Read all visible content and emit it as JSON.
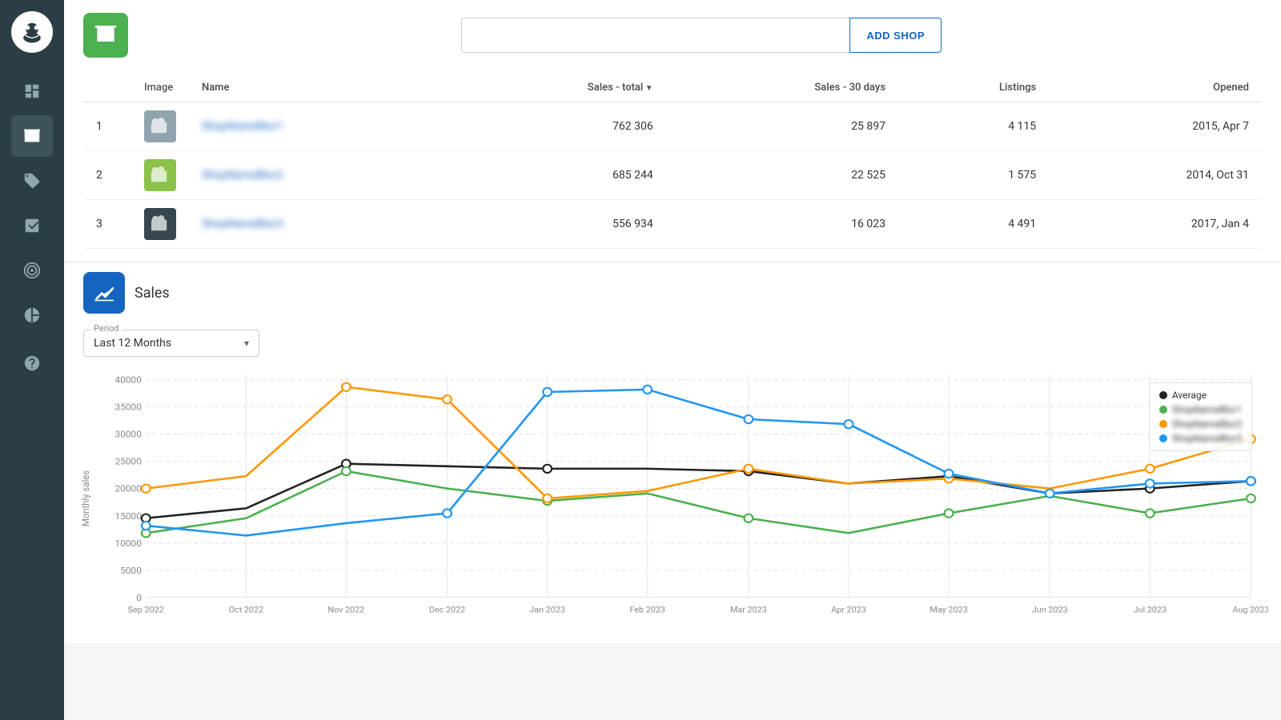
{
  "sidebar": {
    "items": [
      {
        "id": "dashboard",
        "icon": "📊",
        "label": "Dashboard"
      },
      {
        "id": "shops",
        "icon": "🏪",
        "label": "Shops",
        "active": true
      },
      {
        "id": "tags",
        "icon": "🏷️",
        "label": "Tags"
      },
      {
        "id": "analytics",
        "icon": "📈",
        "label": "Analytics"
      },
      {
        "id": "targets",
        "icon": "🎯",
        "label": "Targets"
      },
      {
        "id": "reports",
        "icon": "📉",
        "label": "Reports"
      },
      {
        "id": "help",
        "icon": "❓",
        "label": "Help"
      }
    ]
  },
  "header": {
    "shop_icon_label": "Shop",
    "search_placeholder": "",
    "add_shop_label": "ADD SHOP"
  },
  "table": {
    "columns": [
      "Image",
      "Name",
      "Sales - total",
      "Sales - 30 days",
      "Listings",
      "Opened"
    ],
    "rows": [
      {
        "num": 1,
        "thumb_style": "gray",
        "name": "ShopNameBlur1",
        "sales_total": "762 306",
        "sales_30": "25 897",
        "listings": "4 115",
        "opened": "2015, Apr 7"
      },
      {
        "num": 2,
        "thumb_style": "green",
        "name": "ShopNameBlur2",
        "sales_total": "685 244",
        "sales_30": "22 525",
        "listings": "1 575",
        "opened": "2014, Oct 31"
      },
      {
        "num": 3,
        "thumb_style": "dark",
        "name": "ShopNameBlur3",
        "sales_total": "556 934",
        "sales_30": "16 023",
        "listings": "4 491",
        "opened": "2017, Jan 4"
      }
    ]
  },
  "sales_panel": {
    "title": "Sales",
    "period_label": "Period",
    "period_value": "Last 12 Months",
    "legend": {
      "average": "Average",
      "shop1_name": "ShopNameBlur1",
      "shop2_name": "ShopNameBlur2",
      "shop3_name": "ShopNameBlur3",
      "colors": {
        "average": "#222",
        "shop1": "#4caf50",
        "shop2": "#ff9800",
        "shop3": "#2196f3"
      }
    },
    "chart": {
      "x_labels": [
        "Sep 2022",
        "Oct 2022",
        "Nov 2022",
        "Dec 2022",
        "Jan 2023",
        "Feb 2023",
        "Mar 2023",
        "Apr 2023",
        "May 2023",
        "Jun 2023",
        "Jul 2023",
        "Aug 2023"
      ],
      "y_labels": [
        "0",
        "5000",
        "10000",
        "15000",
        "20000",
        "25000",
        "30000",
        "35000",
        "40000"
      ],
      "y_axis_label": "Monthly sales",
      "series": {
        "average": [
          16000,
          18000,
          27000,
          26500,
          26000,
          26000,
          25500,
          23000,
          24500,
          21000,
          22000,
          23500
        ],
        "shop1_green": [
          13000,
          16000,
          25500,
          22000,
          19500,
          21000,
          16000,
          13000,
          17000,
          20500,
          17000,
          20000
        ],
        "shop2_orange": [
          22000,
          24500,
          42500,
          40000,
          20000,
          21500,
          26000,
          23000,
          24000,
          22000,
          26000,
          32000
        ],
        "shop3_blue": [
          14500,
          12500,
          15000,
          17000,
          41500,
          42000,
          36000,
          35000,
          25000,
          21000,
          23000,
          23500
        ]
      }
    }
  }
}
